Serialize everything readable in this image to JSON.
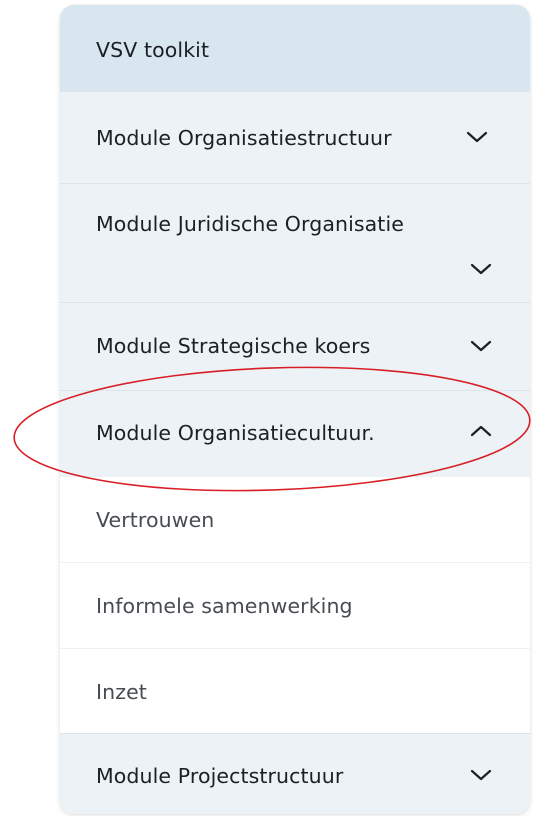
{
  "nav": {
    "title": "VSV toolkit",
    "modules": [
      {
        "label": "Module Organisatiestructuur",
        "state": "collapsed",
        "icon": "chevron-down-icon"
      },
      {
        "label": "Module Juridische Organisatie",
        "state": "collapsed",
        "icon": "chevron-down-icon"
      },
      {
        "label": "Module Strategische koers",
        "state": "collapsed",
        "icon": "chevron-down-icon"
      },
      {
        "label": "Module Organisatiecultuur.",
        "state": "expanded",
        "icon": "chevron-up-icon"
      },
      {
        "label": "Module Projectstructuur",
        "state": "collapsed",
        "icon": "chevron-down-icon"
      }
    ],
    "subitems": [
      {
        "label": "Vertrouwen"
      },
      {
        "label": "Informele samenwerking"
      },
      {
        "label": "Inzet"
      }
    ]
  },
  "colors": {
    "title_bg": "#d8e6ef",
    "module_bg": "#ecf2f6",
    "subitem_bg": "#ffffff",
    "highlight_ellipse": "#d81f26"
  }
}
